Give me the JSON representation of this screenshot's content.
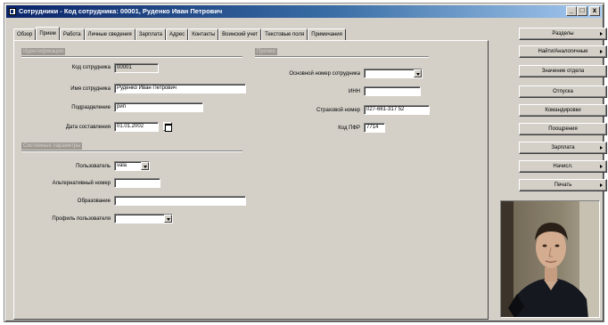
{
  "window": {
    "title": "Сотрудники - Код сотрудника: 00001, Руденко Иван Петрович",
    "buttons": {
      "minimize": "_",
      "maximize": "□",
      "close": "x"
    }
  },
  "tabs": [
    {
      "label": "Обзор"
    },
    {
      "label": "Прием"
    },
    {
      "label": "Работа"
    },
    {
      "label": "Личные сведения"
    },
    {
      "label": "Зарплата"
    },
    {
      "label": "Адрес"
    },
    {
      "label": "Контакты"
    },
    {
      "label": "Воинский учет"
    },
    {
      "label": "Текстовые поля"
    },
    {
      "label": "Примечания"
    }
  ],
  "active_tab": "Прием",
  "groups": {
    "identification": "Идентификация",
    "system": "Системные параметры",
    "payroll": "Прочее"
  },
  "form": {
    "employee_code_label": "Код сотрудника",
    "employee_code_value": "00001",
    "employee_name_label": "Имя сотрудника",
    "employee_name_value": "Руденко Иван Петрович",
    "position_label": "Подразделение",
    "position_value": "рип",
    "created_label": "Дата составления",
    "created_value": "01.01.2002",
    "user_label": "Пользователь",
    "user_value": "vala",
    "alt_number_label": "Альтернативный номер",
    "alt_number_value": "",
    "education_label": "Образование",
    "education_value": "",
    "profile_label": "Профиль пользователя",
    "profile_value": "",
    "main_number_label": "Основной номер сотрудника",
    "main_number_value": "",
    "inn_label": "ИНН",
    "inn_value": "",
    "insurance_label": "Страховой номер",
    "insurance_value": "027-661-317 52",
    "tax_code_label": "Код ПФР",
    "tax_code_value": "7714"
  },
  "side_buttons": [
    {
      "label": "Разделы",
      "has_arrow": true
    },
    {
      "label": "Найти/Аналогичные",
      "has_arrow": true
    },
    {
      "label": "Значение отдела",
      "has_arrow": false
    },
    {
      "label": "Отпуска",
      "has_arrow": false
    },
    {
      "label": "Командировки",
      "has_arrow": false
    },
    {
      "label": "Поощрения",
      "has_arrow": false
    },
    {
      "label": "Зарплата",
      "has_arrow": true
    },
    {
      "label": "Начисл.",
      "has_arrow": true
    },
    {
      "label": "Печать",
      "has_arrow": true
    }
  ],
  "colors": {
    "face": "#d4d0c8",
    "title_start": "#0a246a",
    "title_end": "#a6caf0"
  }
}
